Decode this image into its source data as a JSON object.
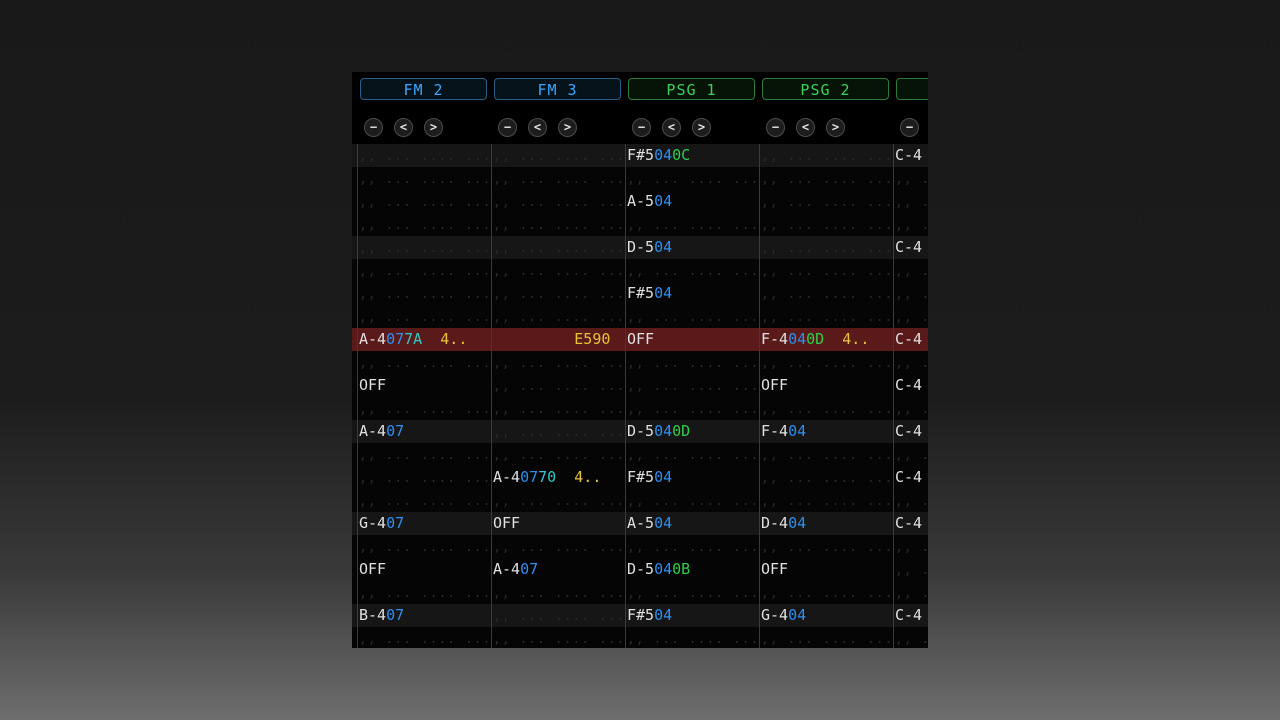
{
  "channels": [
    {
      "name": "FM 2",
      "color": "#3aa8ff",
      "border": "#2a5e86"
    },
    {
      "name": "FM 3",
      "color": "#3aa8ff",
      "border": "#2a5e86"
    },
    {
      "name": "PSG 1",
      "color": "#3fd05a",
      "border": "#2e7a3d"
    },
    {
      "name": "PSG 2",
      "color": "#3fd05a",
      "border": "#2e7a3d"
    },
    {
      "name": "",
      "color": "#3fd05a",
      "border": "#2e7a3d"
    }
  ],
  "controls": {
    "minus": "−",
    "prev": "<",
    "next": ">"
  },
  "rows": [
    {
      "bg": "#161616",
      "cells": [
        null,
        null,
        [
          [
            "F#5",
            "note"
          ],
          [
            "04",
            "ins"
          ],
          [
            "0C",
            "vol"
          ]
        ],
        null,
        [
          [
            "C-4",
            "note"
          ]
        ]
      ]
    },
    {
      "bg": "#050505",
      "cells": [
        null,
        null,
        null,
        null,
        null
      ]
    },
    {
      "bg": "#050505",
      "cells": [
        null,
        null,
        [
          [
            "A-5",
            "note"
          ],
          [
            "04",
            "ins"
          ]
        ],
        null,
        null
      ]
    },
    {
      "bg": "#050505",
      "cells": [
        null,
        null,
        null,
        null,
        null
      ]
    },
    {
      "bg": "#161616",
      "cells": [
        null,
        null,
        [
          [
            "D-5",
            "note"
          ],
          [
            "04",
            "ins"
          ]
        ],
        null,
        [
          [
            "C-4",
            "note"
          ]
        ]
      ]
    },
    {
      "bg": "#050505",
      "cells": [
        null,
        null,
        null,
        null,
        null
      ]
    },
    {
      "bg": "#050505",
      "cells": [
        null,
        null,
        [
          [
            "F#5",
            "note"
          ],
          [
            "04",
            "ins"
          ]
        ],
        null,
        null
      ]
    },
    {
      "bg": "#050505",
      "cells": [
        null,
        null,
        null,
        null,
        null
      ]
    },
    {
      "bg": "#5a1a1a",
      "cells": [
        [
          [
            "A-4",
            "note"
          ],
          [
            "07",
            "ins"
          ],
          [
            "7A",
            "vol2"
          ],
          [
            "  4..",
            "eff"
          ]
        ],
        [
          [
            "         E590",
            "eff"
          ]
        ],
        [
          [
            "OFF",
            "note"
          ]
        ],
        [
          [
            "F-4",
            "note"
          ],
          [
            "04",
            "ins"
          ],
          [
            "0D",
            "vol"
          ],
          [
            "  4..",
            "eff"
          ]
        ],
        [
          [
            "C-4",
            "note"
          ]
        ]
      ]
    },
    {
      "bg": "#050505",
      "cells": [
        null,
        null,
        null,
        null,
        null
      ]
    },
    {
      "bg": "#050505",
      "cells": [
        [
          [
            "OFF",
            "note"
          ]
        ],
        null,
        null,
        [
          [
            "OFF",
            "note"
          ]
        ],
        [
          [
            "C-4",
            "note"
          ]
        ]
      ]
    },
    {
      "bg": "#050505",
      "cells": [
        null,
        null,
        null,
        null,
        null
      ]
    },
    {
      "bg": "#161616",
      "cells": [
        [
          [
            "A-4",
            "note"
          ],
          [
            "07",
            "ins"
          ]
        ],
        null,
        [
          [
            "D-5",
            "note"
          ],
          [
            "04",
            "ins"
          ],
          [
            "0D",
            "vol"
          ]
        ],
        [
          [
            "F-4",
            "note"
          ],
          [
            "04",
            "ins"
          ]
        ],
        [
          [
            "C-4",
            "note"
          ]
        ]
      ]
    },
    {
      "bg": "#050505",
      "cells": [
        null,
        null,
        null,
        null,
        null
      ]
    },
    {
      "bg": "#050505",
      "cells": [
        null,
        [
          [
            "A-4",
            "note"
          ],
          [
            "07",
            "ins"
          ],
          [
            "70",
            "vol2"
          ],
          [
            "  4..",
            "eff"
          ]
        ],
        [
          [
            "F#5",
            "note"
          ],
          [
            "04",
            "ins"
          ]
        ],
        null,
        [
          [
            "C-4",
            "note"
          ]
        ]
      ]
    },
    {
      "bg": "#050505",
      "cells": [
        null,
        null,
        null,
        null,
        null
      ]
    },
    {
      "bg": "#161616",
      "cells": [
        [
          [
            "G-4",
            "note"
          ],
          [
            "07",
            "ins"
          ]
        ],
        [
          [
            "OFF",
            "note"
          ]
        ],
        [
          [
            "A-5",
            "note"
          ],
          [
            "04",
            "ins"
          ]
        ],
        [
          [
            "D-4",
            "note"
          ],
          [
            "04",
            "ins"
          ]
        ],
        [
          [
            "C-4",
            "note"
          ]
        ]
      ]
    },
    {
      "bg": "#050505",
      "cells": [
        null,
        null,
        null,
        null,
        null
      ]
    },
    {
      "bg": "#050505",
      "cells": [
        [
          [
            "OFF",
            "note"
          ]
        ],
        [
          [
            "A-4",
            "note"
          ],
          [
            "07",
            "ins"
          ]
        ],
        [
          [
            "D-5",
            "note"
          ],
          [
            "04",
            "ins"
          ],
          [
            "0B",
            "vol"
          ]
        ],
        [
          [
            "OFF",
            "note"
          ]
        ],
        null
      ]
    },
    {
      "bg": "#050505",
      "cells": [
        null,
        null,
        null,
        null,
        null
      ]
    },
    {
      "bg": "#161616",
      "cells": [
        [
          [
            "B-4",
            "note"
          ],
          [
            "07",
            "ins"
          ]
        ],
        null,
        [
          [
            "F#5",
            "note"
          ],
          [
            "04",
            "ins"
          ]
        ],
        [
          [
            "G-4",
            "note"
          ],
          [
            "04",
            "ins"
          ]
        ],
        [
          [
            "C-4",
            "note"
          ]
        ]
      ]
    },
    {
      "bg": "#050505",
      "cells": [
        null,
        null,
        null,
        null,
        null
      ]
    }
  ]
}
